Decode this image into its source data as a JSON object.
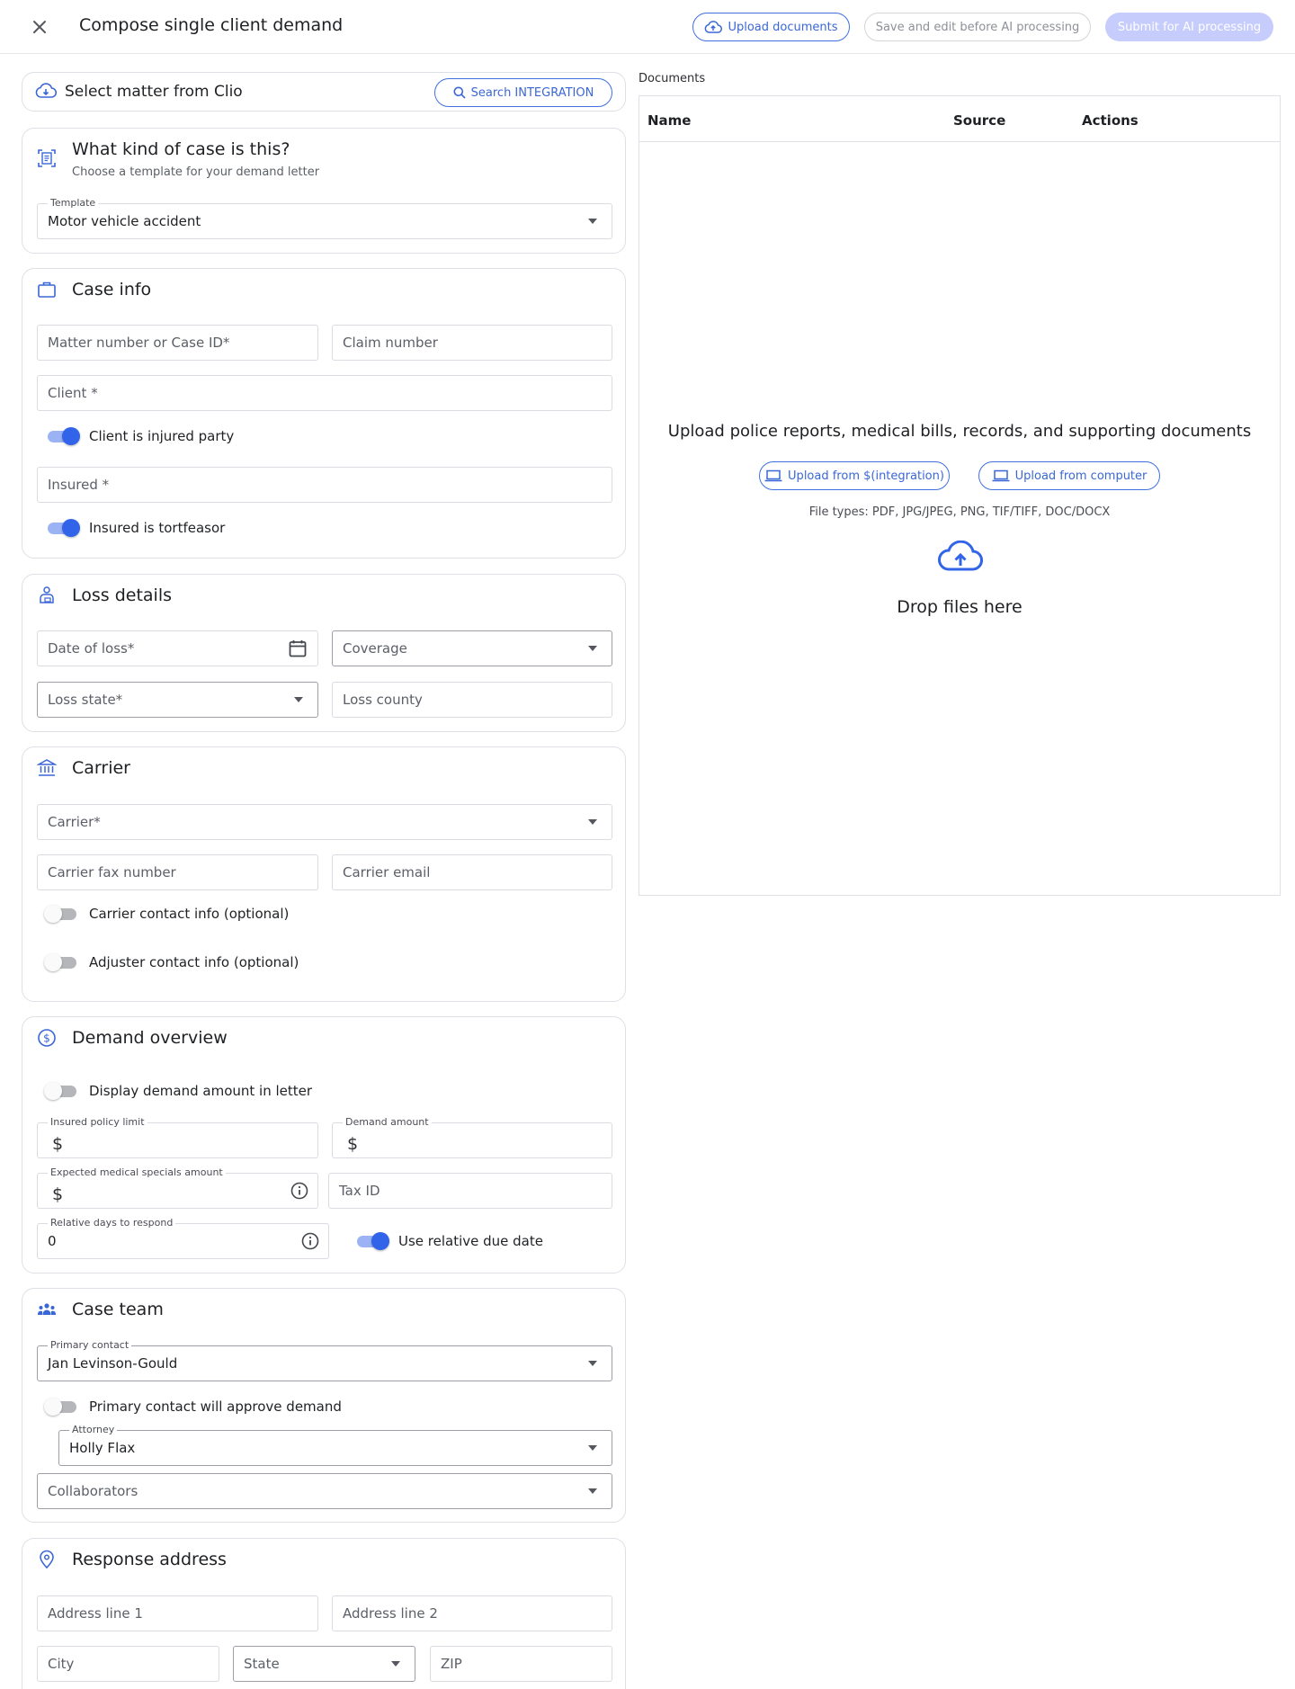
{
  "header": {
    "title": "Compose single client demand",
    "upload_documents": "Upload documents",
    "save_edit": "Save and edit before AI processing",
    "submit": "Submit for AI processing"
  },
  "clio": {
    "label": "Select matter from Clio",
    "search_button": "Search INTEGRATION"
  },
  "case_type": {
    "title": "What kind of case is this?",
    "subtitle": "Choose a template for your demand letter",
    "template_label": "Template",
    "template_value": "Motor vehicle accident"
  },
  "case_info": {
    "title": "Case info",
    "matter_placeholder": "Matter number or Case ID*",
    "claim_placeholder": "Claim number",
    "client_placeholder": "Client *",
    "client_injured_label": "Client is injured party",
    "insured_placeholder": "Insured *",
    "insured_tortfeasor_label": "Insured is tortfeasor"
  },
  "loss_details": {
    "title": "Loss details",
    "date_placeholder": "Date of loss*",
    "coverage_placeholder": "Coverage",
    "state_placeholder": "Loss state*",
    "county_placeholder": "Loss county"
  },
  "carrier": {
    "title": "Carrier",
    "carrier_placeholder": "Carrier*",
    "fax_placeholder": "Carrier fax number",
    "email_placeholder": "Carrier email",
    "contact_toggle": "Carrier contact info (optional)",
    "adjuster_toggle": "Adjuster contact info (optional)"
  },
  "demand": {
    "title": "Demand overview",
    "display_toggle": "Display demand amount in letter",
    "policy_label": "Insured policy limit",
    "demand_label": "Demand amount",
    "medical_label": "Expected medical specials amount",
    "tax_placeholder": "Tax ID",
    "days_label": "Relative days to respond",
    "days_value": "0",
    "relative_toggle": "Use relative due date",
    "currency": "$"
  },
  "team": {
    "title": "Case team",
    "primary_label": "Primary contact",
    "primary_value": "Jan Levinson-Gould",
    "approve_toggle": "Primary contact will approve demand",
    "attorney_label": "Attorney",
    "attorney_value": "Holly Flax",
    "collaborators_placeholder": "Collaborators"
  },
  "address": {
    "title": "Response address",
    "line1_placeholder": "Address line 1",
    "line2_placeholder": "Address line 2",
    "city_placeholder": "City",
    "state_placeholder": "State",
    "zip_placeholder": "ZIP"
  },
  "documents": {
    "label": "Documents",
    "col_name": "Name",
    "col_source": "Source",
    "col_actions": "Actions",
    "headline": "Upload police reports, medical bills, records, and supporting documents",
    "upload_integration": "Upload from $(integration)",
    "upload_computer": "Upload from computer",
    "file_types": "File types: PDF, JPG/JPEG, PNG, TIF/TIFF, DOC/DOCX",
    "drop": "Drop files here"
  },
  "toggles": {
    "client_injured": true,
    "insured_tortfeasor": true,
    "carrier_contact": false,
    "adjuster_contact": false,
    "display_demand": false,
    "relative_due": true,
    "primary_approve": false
  },
  "colors": {
    "accent": "#3264ea",
    "border": "#dde0e4",
    "disabled": "#c6cdfd"
  }
}
